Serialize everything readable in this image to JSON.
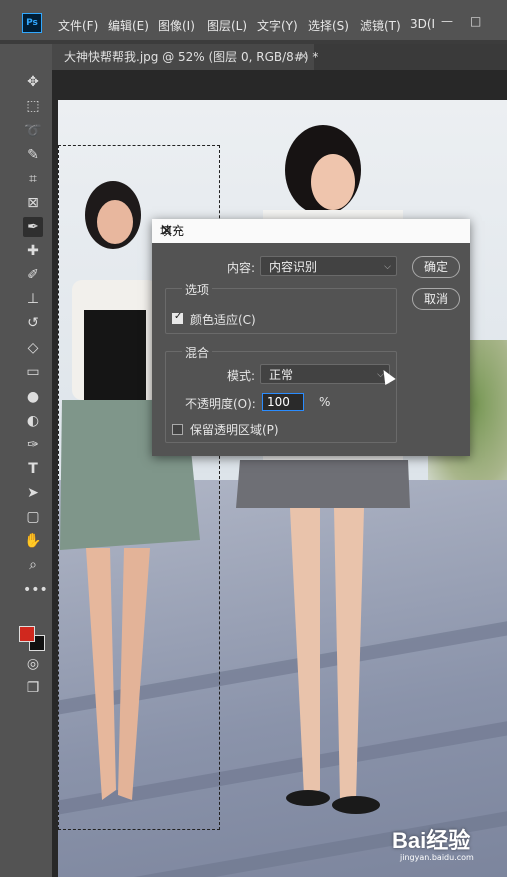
{
  "app": {
    "logo": "Ps"
  },
  "menu": [
    "文件(F)",
    "编辑(E)",
    "图像(I)",
    "图层(L)",
    "文字(Y)",
    "选择(S)",
    "滤镜(T)",
    "3D(I"
  ],
  "window_controls": [
    "—",
    "□"
  ],
  "tab": {
    "title": "大神快帮帮我.jpg @ 52% (图层 0, RGB/8#) *",
    "close": "×"
  },
  "tools": [
    "move-icon",
    "marquee-icon",
    "lasso-icon",
    "quick-select-icon",
    "crop-icon",
    "frame-icon",
    "eyedropper-icon",
    "healing-icon",
    "brush-icon",
    "stamp-icon",
    "history-brush-icon",
    "eraser-icon",
    "gradient-icon",
    "blur-icon",
    "dodge-icon",
    "pen-icon",
    "type-icon",
    "path-select-icon",
    "rectangle-icon",
    "hand-icon",
    "zoom-icon",
    "more-icon"
  ],
  "colors": {
    "foreground": "#d0281e",
    "background": "#111111",
    "accent": "#2a8cff"
  },
  "dialog": {
    "title": "填充",
    "content_label": "内容:",
    "content_value": "内容识别",
    "ok": "确定",
    "cancel": "取消",
    "options_label": "选项",
    "color_adapt": "颜色适应(C)",
    "color_adapt_checked": true,
    "blend_label": "混合",
    "mode_label": "模式:",
    "mode_value": "正常",
    "opacity_label": "不透明度(O):",
    "opacity_value": "100",
    "opacity_unit": "%",
    "preserve_transparency": "保留透明区域(P)",
    "preserve_checked": false
  },
  "watermark": {
    "brand": "Bai经验",
    "url": "jingyan.baidu.com"
  }
}
